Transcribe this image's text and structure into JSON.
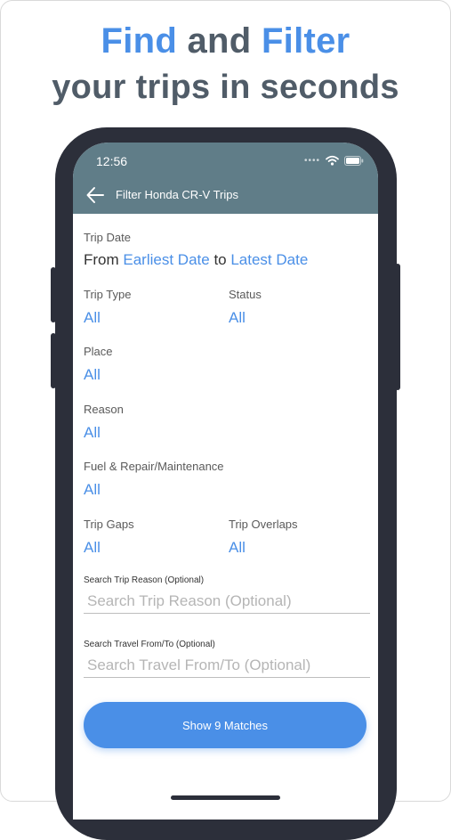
{
  "headline": {
    "accent1": "Find",
    "mid": " and ",
    "accent2": "Filter",
    "line2": "your trips in seconds"
  },
  "status_bar": {
    "time": "12:56",
    "icons": [
      "signal-dots-icon",
      "wifi-icon",
      "battery-icon"
    ]
  },
  "nav": {
    "back_icon": "arrow-left-icon",
    "title": "Filter Honda CR-V Trips"
  },
  "filters": {
    "trip_date": {
      "label": "Trip Date",
      "prefix": "From ",
      "start": "Earliest Date",
      "middle": " to ",
      "end": "Latest Date"
    },
    "trip_type": {
      "label": "Trip Type",
      "value": "All"
    },
    "status": {
      "label": "Status",
      "value": "All"
    },
    "place": {
      "label": "Place",
      "value": "All"
    },
    "reason": {
      "label": "Reason",
      "value": "All"
    },
    "fuel_repair": {
      "label": "Fuel & Repair/Maintenance",
      "value": "All"
    },
    "trip_gaps": {
      "label": "Trip Gaps",
      "value": "All"
    },
    "trip_overlaps": {
      "label": "Trip Overlaps",
      "value": "All"
    }
  },
  "search_reason": {
    "label": "Search Trip Reason (Optional)",
    "placeholder": "Search Trip Reason (Optional)",
    "value": ""
  },
  "search_travel": {
    "label": "Search Travel From/To (Optional)",
    "placeholder": "Search Travel From/To (Optional)",
    "value": ""
  },
  "cta": {
    "label": "Show 9 Matches"
  },
  "colors": {
    "accent": "#4a8fe7",
    "appbar": "#607d88",
    "phone": "#2c2f3a",
    "headline": "#505c68"
  }
}
